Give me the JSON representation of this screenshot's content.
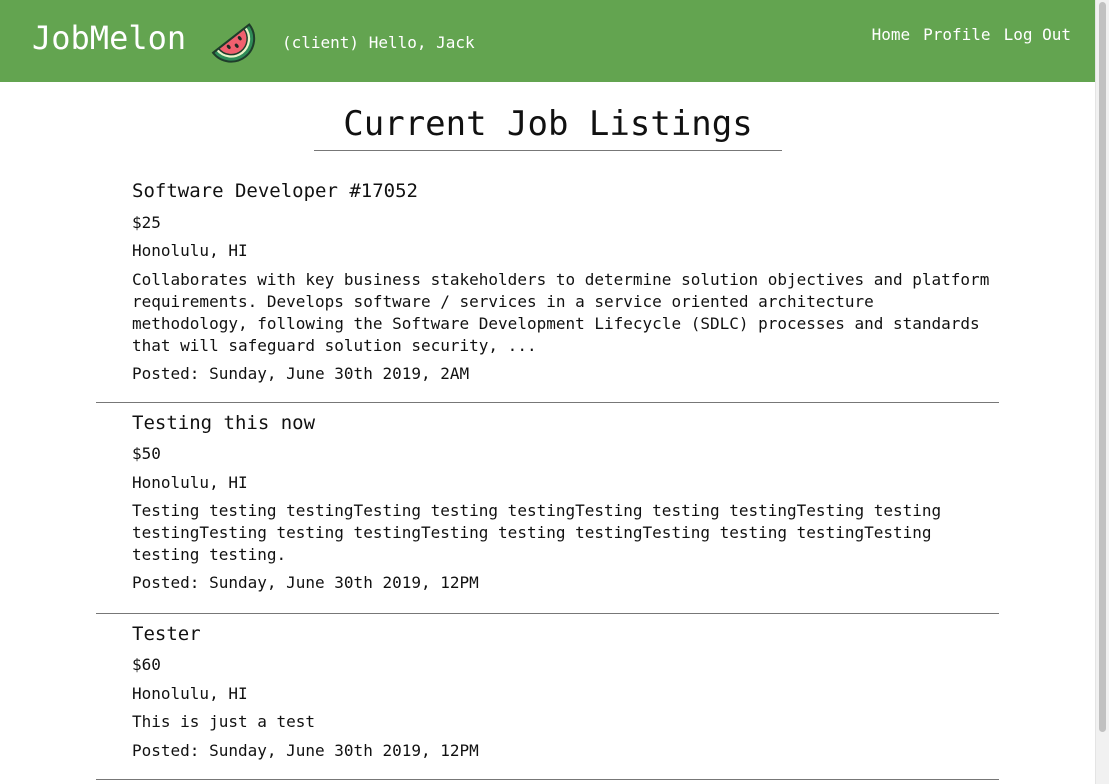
{
  "header": {
    "brand": "JobMelon",
    "logo_icon": "watermelon-icon",
    "greeting": "(client) Hello, Jack",
    "nav": [
      "Home",
      "Profile",
      "Log Out"
    ],
    "background_color": "#63a450"
  },
  "main": {
    "title": "Current Job Listings",
    "listings": [
      {
        "title": "Software Developer #17052",
        "pay": "$25",
        "location": "Honolulu, HI",
        "description": "Collaborates with key business stakeholders to determine solution objectives and platform requirements. Develops software / services in a service oriented architecture methodology, following the Software Development Lifecycle (SDLC) processes and standards that will safeguard solution security, ...",
        "posted": "Posted: Sunday, June 30th 2019, 2AM"
      },
      {
        "title": "Testing this now",
        "pay": "$50",
        "location": "Honolulu, HI",
        "description": "Testing testing testingTesting testing testingTesting testing testingTesting testing testingTesting testing testingTesting testing testingTesting testing testingTesting testing testing.",
        "posted": "Posted: Sunday, June 30th 2019, 12PM"
      },
      {
        "title": "Tester",
        "pay": "$60",
        "location": "Honolulu, HI",
        "description": "This is just a test",
        "posted": "Posted: Sunday, June 30th 2019, 12PM"
      }
    ]
  }
}
